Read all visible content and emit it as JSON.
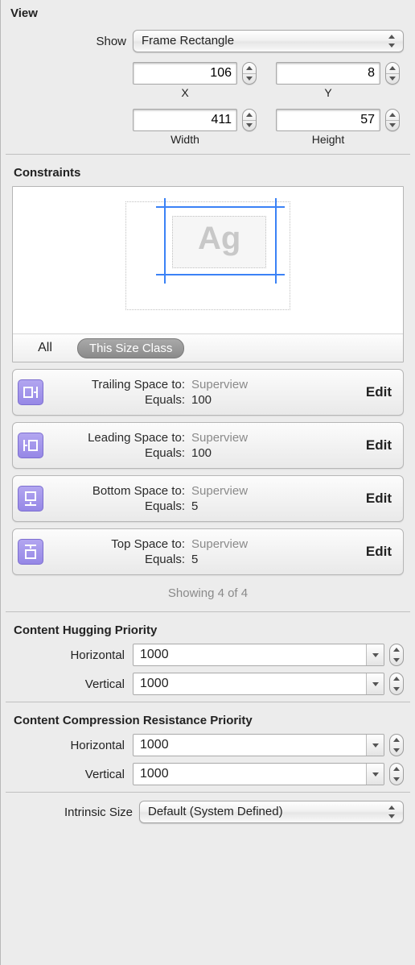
{
  "view": {
    "title": "View",
    "show_label": "Show",
    "show_value": "Frame Rectangle",
    "x_label": "X",
    "x_value": "106",
    "y_label": "Y",
    "y_value": "8",
    "width_label": "Width",
    "width_value": "411",
    "height_label": "Height",
    "height_value": "57"
  },
  "constraints": {
    "title": "Constraints",
    "diagram_placeholder": "Ag",
    "seg_all": "All",
    "seg_sizeclass": "This Size Class",
    "items": [
      {
        "icon": "trailing",
        "attr": "Trailing Space to:",
        "target": "Superview",
        "rel": "Equals:",
        "value": "100",
        "edit": "Edit"
      },
      {
        "icon": "leading",
        "attr": "Leading Space to:",
        "target": "Superview",
        "rel": "Equals:",
        "value": "100",
        "edit": "Edit"
      },
      {
        "icon": "bottom",
        "attr": "Bottom Space to:",
        "target": "Superview",
        "rel": "Equals:",
        "value": "5",
        "edit": "Edit"
      },
      {
        "icon": "top",
        "attr": "Top Space to:",
        "target": "Superview",
        "rel": "Equals:",
        "value": "5",
        "edit": "Edit"
      }
    ],
    "showing": "Showing 4 of 4"
  },
  "hugging": {
    "title": "Content Hugging Priority",
    "h_label": "Horizontal",
    "h_value": "1000",
    "v_label": "Vertical",
    "v_value": "1000"
  },
  "compression": {
    "title": "Content Compression Resistance Priority",
    "h_label": "Horizontal",
    "h_value": "1000",
    "v_label": "Vertical",
    "v_value": "1000"
  },
  "intrinsic": {
    "label": "Intrinsic Size",
    "value": "Default (System Defined)"
  }
}
